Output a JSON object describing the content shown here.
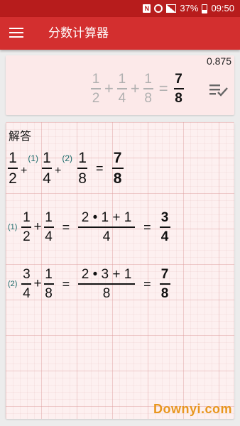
{
  "status_bar": {
    "battery": "37%",
    "time": "09:50",
    "nfc": "N"
  },
  "app_bar": {
    "title": "分数计算器"
  },
  "input_card": {
    "decimal": "0.875",
    "expression": {
      "f1": {
        "num": "1",
        "den": "2"
      },
      "op1": "+",
      "f2": {
        "num": "1",
        "den": "4"
      },
      "op2": "+",
      "f3": {
        "num": "1",
        "den": "8"
      },
      "eq": "=",
      "result": {
        "num": "7",
        "den": "8"
      }
    }
  },
  "answer": {
    "label": "解答",
    "overview": {
      "f1": {
        "num": "1",
        "den": "2"
      },
      "op1": "+",
      "mark1": "(1)",
      "f2": {
        "num": "1",
        "den": "4"
      },
      "op2": "+",
      "mark2": "(2)",
      "f3": {
        "num": "1",
        "den": "8"
      },
      "eq": "=",
      "result": {
        "num": "7",
        "den": "8"
      }
    },
    "steps": [
      {
        "mark": "(1)",
        "a": {
          "num": "1",
          "den": "2"
        },
        "op": "+",
        "b": {
          "num": "1",
          "den": "4"
        },
        "eq1": "=",
        "mid": {
          "num": "2 • 1 + 1",
          "den": "4"
        },
        "eq2": "=",
        "result": {
          "num": "3",
          "den": "4"
        }
      },
      {
        "mark": "(2)",
        "a": {
          "num": "3",
          "den": "4"
        },
        "op": "+",
        "b": {
          "num": "1",
          "den": "8"
        },
        "eq1": "=",
        "mid": {
          "num": "2 • 3 + 1",
          "den": "8"
        },
        "eq2": "=",
        "result": {
          "num": "7",
          "den": "8"
        }
      }
    ]
  },
  "watermark": "Downyi.com",
  "colors": {
    "status_bar": "#b71c1c",
    "app_bar": "#d32f2f",
    "card": "#fce9e9",
    "step_mark": "#1b6a6a",
    "watermark": "#e8961e"
  },
  "icons": {
    "menu": "hamburger-menu-icon",
    "history": "list-check-icon"
  }
}
